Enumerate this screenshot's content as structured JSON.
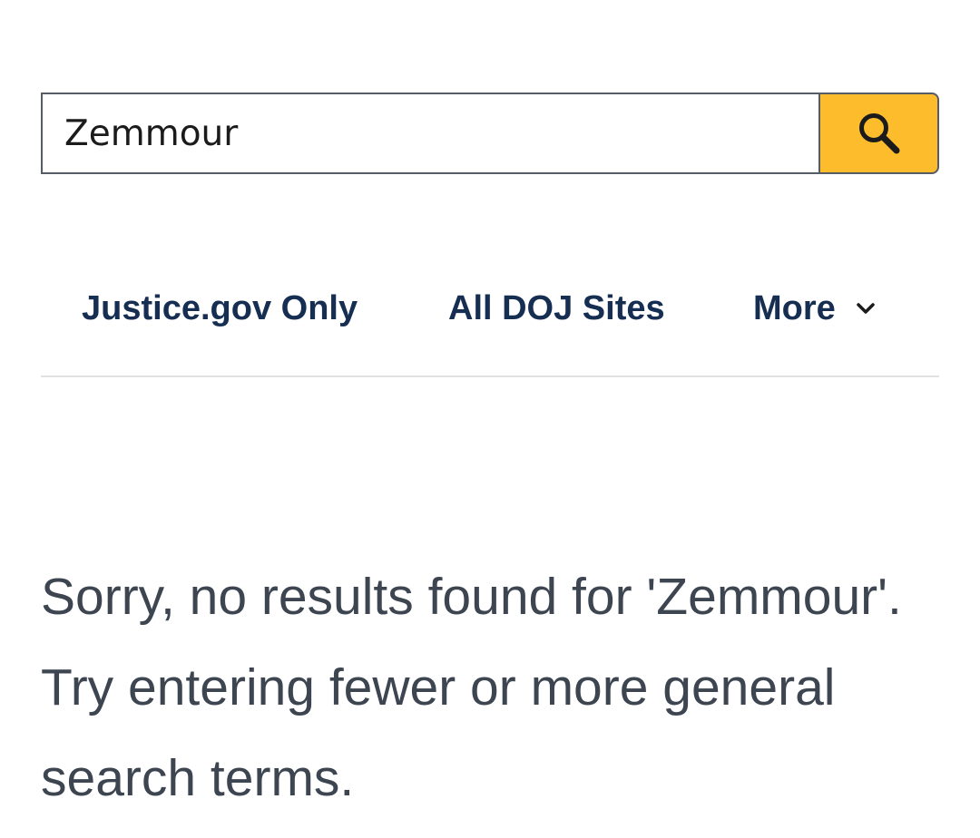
{
  "search": {
    "value": "Zemmour",
    "placeholder": "",
    "button_icon": "search-icon",
    "button_color": "#fdbc2b"
  },
  "tabs": [
    {
      "label": "Justice.gov Only"
    },
    {
      "label": "All DOJ Sites"
    },
    {
      "label": "More",
      "icon": "chevron-down-icon"
    }
  ],
  "results": {
    "message": "Sorry, no results found for 'Zemmour'. Try entering fewer or more general search terms."
  },
  "colors": {
    "tab_text": "#162e51",
    "message_text": "#3d4551",
    "divider": "#dfe1e2"
  }
}
